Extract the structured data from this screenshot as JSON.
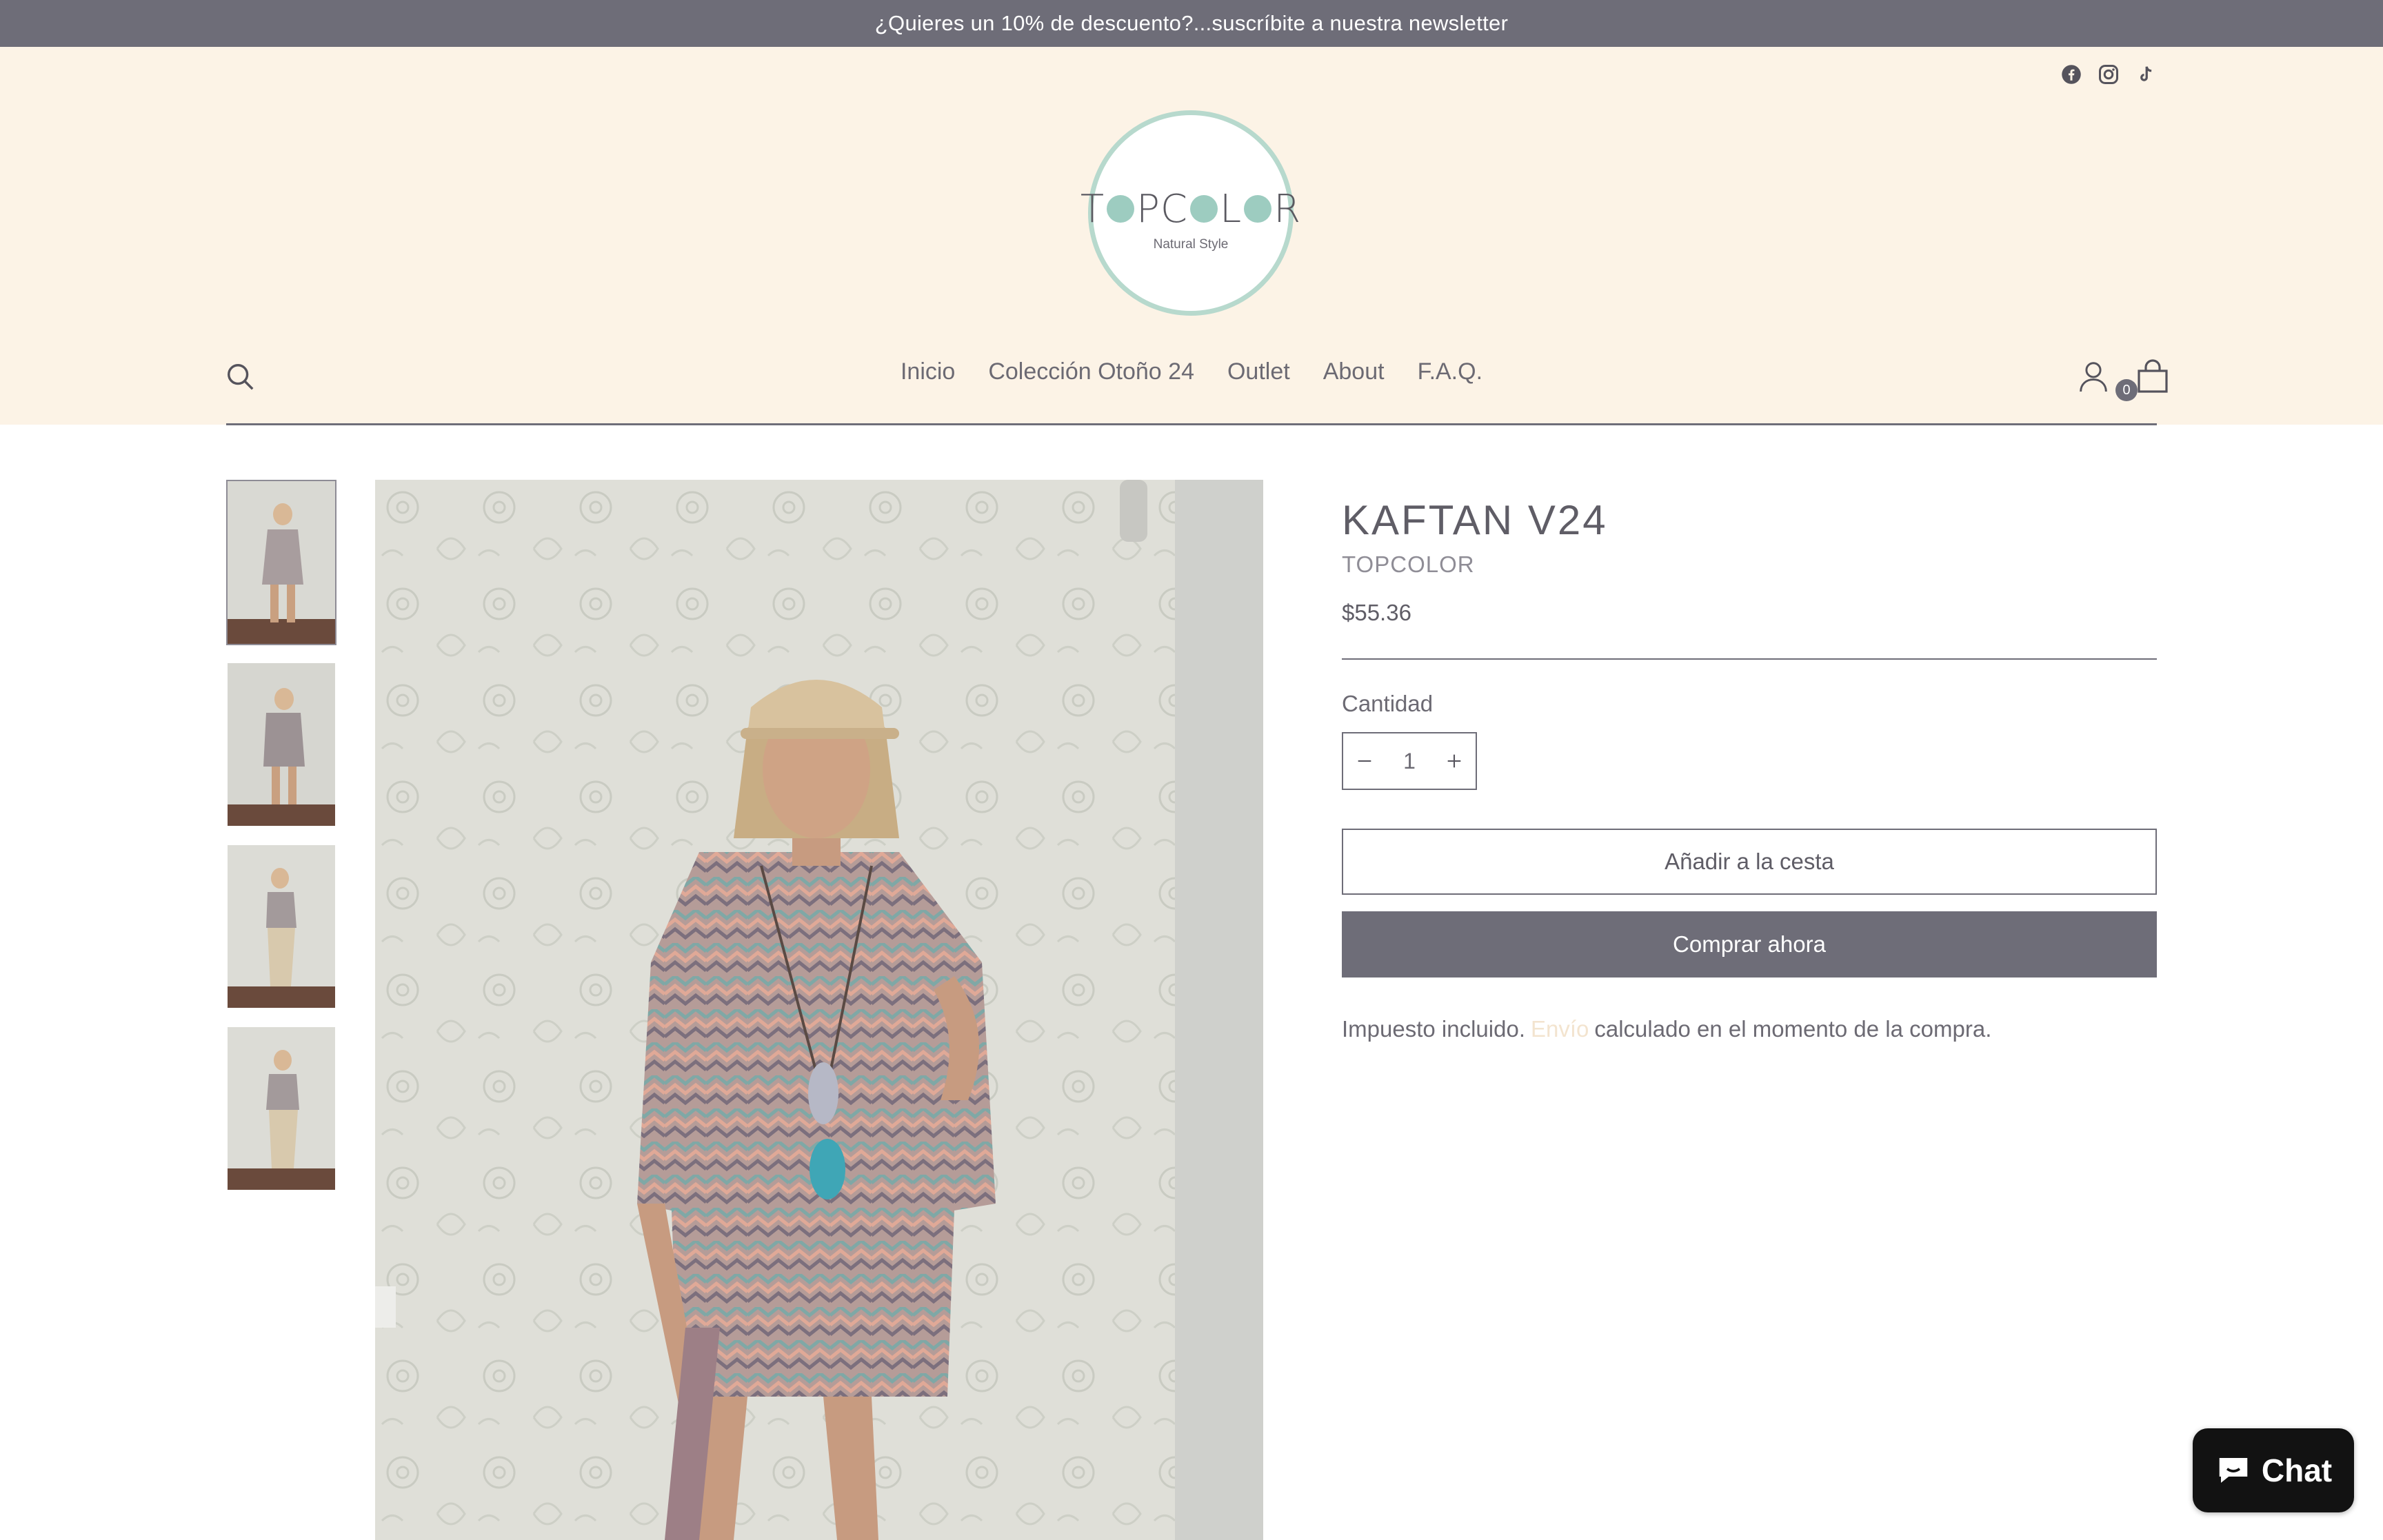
{
  "announcement": "¿Quieres un 10% de descuento?...suscríbite a nuestra newsletter",
  "social": [
    "facebook-icon",
    "instagram-icon",
    "tiktok-icon"
  ],
  "logo": {
    "word": "TOPCOLOR",
    "sub": "Natural Style"
  },
  "nav": {
    "items": [
      {
        "label": "Inicio"
      },
      {
        "label": "Colección Otoño 24"
      },
      {
        "label": "Outlet"
      },
      {
        "label": "About"
      },
      {
        "label": "F.A.Q."
      }
    ],
    "cart_count": "0"
  },
  "product": {
    "title": "KAFTAN V24",
    "vendor": "TOPCOLOR",
    "price": "$55.36",
    "quantity_label": "Cantidad",
    "quantity": "1",
    "add_to_cart": "Añadir a la cesta",
    "buy_now": "Comprar ahora",
    "tax_before": "Impuesto incluido.",
    "tax_link": "Envío",
    "tax_after": "calculado en el momento de la compra."
  },
  "chat": {
    "label": "Chat"
  },
  "colors": {
    "accent": "#6e6d78",
    "header_bg": "#fcf3e6",
    "logo_ring": "#b7d9cd"
  }
}
